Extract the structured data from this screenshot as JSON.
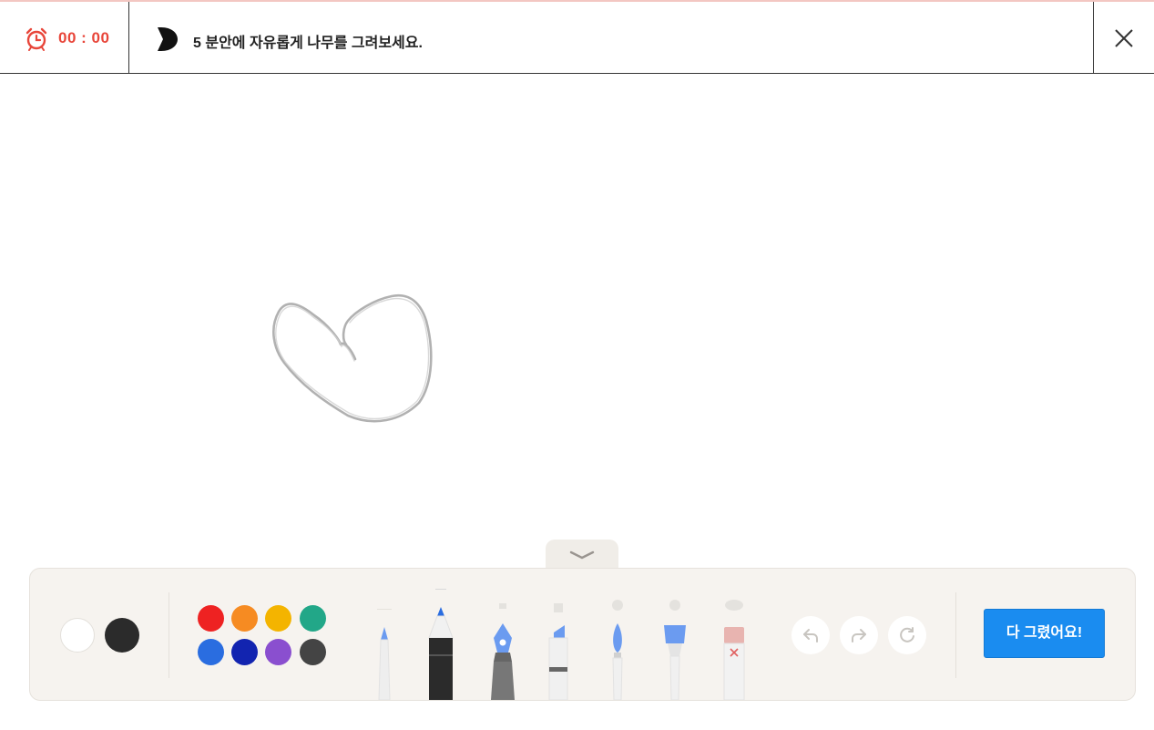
{
  "header": {
    "timer": "00 : 00",
    "prompt": "5 분안에 자유롭게 나무를 그려보세요."
  },
  "toolbar": {
    "base_colors": [
      "#ffffff",
      "#2b2b2b"
    ],
    "palette": [
      "#ee2222",
      "#f68b22",
      "#f4b400",
      "#22a788",
      "#2a6de0",
      "#1224b0",
      "#8a4fcf",
      "#444444"
    ],
    "tools": [
      "pencil",
      "pen",
      "fountain-pen",
      "marker",
      "round-brush",
      "flat-brush",
      "eraser"
    ],
    "done_label": "다 그렸어요!"
  },
  "colors": {
    "accent": "#1a8cf0",
    "timer": "#e8463a"
  }
}
